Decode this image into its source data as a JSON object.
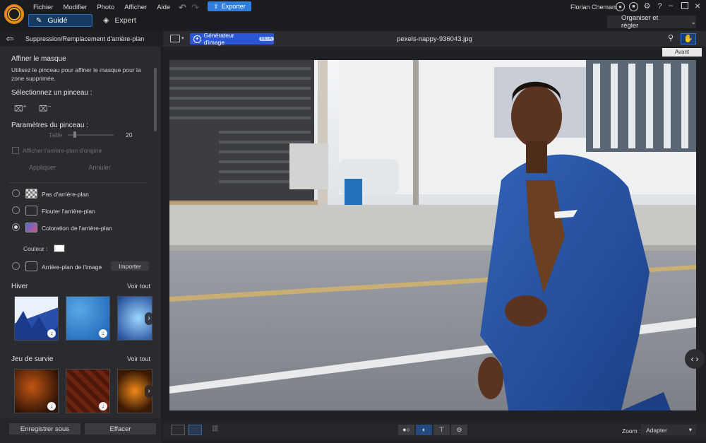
{
  "app": {
    "menu": [
      "Fichier",
      "Modifier",
      "Photo",
      "Afficher",
      "Aide"
    ],
    "export_label": "Exporter",
    "username": "Florian Chemani",
    "mode_guide": "Guidé",
    "mode_expert": "Expert",
    "adjust_label": "Organiser et régler",
    "accent_color": "#2f7fe0",
    "brand_color": "#f2a623"
  },
  "panel": {
    "title": "Suppression/Remplacement d'arrière-plan",
    "refine_title": "Affiner le masque",
    "refine_desc_1": "Utilisez le pinceau pour affiner le masque pour la",
    "refine_desc_2": "zone supprimée.",
    "select_brush": "Sélectionnez un pinceau :",
    "brush_params": "Paramètres du pinceau :",
    "size_label": "Taille",
    "size_value": "20",
    "show_original": "Afficher l'arrière-plan d'origine",
    "apply": "Appliquer",
    "cancel": "Annuler",
    "options": {
      "none": "Pas d'arrière-plan",
      "blur": "Flouter l'arrière-plan",
      "color": "Coloration de l'arrière-plan",
      "image": "Arrière-plan de l'image"
    },
    "selected_option": "color",
    "color_label": "Couleur :",
    "color_value": "#ffffff",
    "import_label": "Importer",
    "section_winter": "Hiver",
    "section_survival": "Jeu de survie",
    "see_all": "Voir tout",
    "save_as": "Enregistrer sous",
    "clear": "Effacer"
  },
  "main": {
    "generator_label": "Générateur d'image",
    "generator_badge": "BETA",
    "filename": "pexels-nappy-936043.jpg",
    "tooltip": "Avant",
    "zoom_label": "Zoom :",
    "zoom_value": "Adapter"
  }
}
